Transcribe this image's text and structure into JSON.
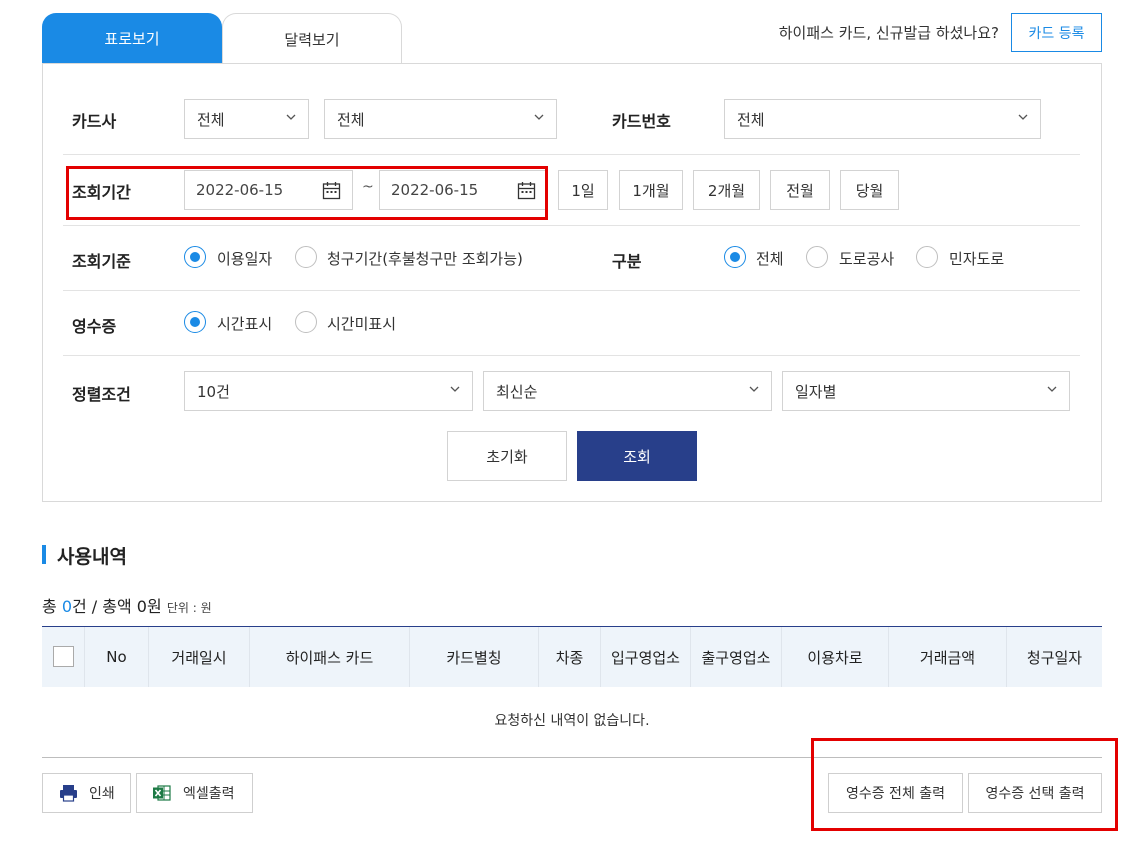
{
  "tabs": [
    {
      "label": "표로보기",
      "active": true
    },
    {
      "label": "달력보기",
      "active": false
    }
  ],
  "header": {
    "question": "하이패스 카드, 신규발급 하셨나요?",
    "card_register_label": "카드 등록"
  },
  "filters": {
    "card_company": {
      "label": "카드사",
      "select1": "전체",
      "select2": "전체"
    },
    "card_number": {
      "label": "카드번호",
      "select": "전체"
    },
    "period": {
      "label": "조회기간",
      "start": "2022-06-15",
      "separator": "~",
      "end": "2022-06-15",
      "buttons": [
        "1일",
        "1개월",
        "2개월",
        "전월",
        "당월"
      ]
    },
    "criteria": {
      "label": "조회기준",
      "options": [
        {
          "label": "이용일자",
          "selected": true
        },
        {
          "label": "청구기간(후불청구만 조회가능)",
          "selected": false
        }
      ]
    },
    "division": {
      "label": "구분",
      "options": [
        {
          "label": "전체",
          "selected": true
        },
        {
          "label": "도로공사",
          "selected": false
        },
        {
          "label": "민자도로",
          "selected": false
        }
      ]
    },
    "receipt": {
      "label": "영수증",
      "options": [
        {
          "label": "시간표시",
          "selected": true
        },
        {
          "label": "시간미표시",
          "selected": false
        }
      ]
    },
    "sort": {
      "label": "정렬조건",
      "select1": "10건",
      "select2": "최신순",
      "select3": "일자별"
    },
    "reset_label": "초기화",
    "search_label": "조회"
  },
  "history": {
    "title": "사용내역",
    "summary_prefix": "총 ",
    "count": "0",
    "summary_mid": "건 / 총액 0원",
    "unit": "단위 : 원",
    "columns": [
      "No",
      "거래일시",
      "하이패스 카드",
      "카드별칭",
      "차종",
      "입구영업소",
      "출구영업소",
      "이용차로",
      "거래금액",
      "청구일자"
    ],
    "empty_message": "요청하신 내역이 없습니다."
  },
  "footer": {
    "print_label": "인쇄",
    "excel_label": "엑셀출력",
    "receipt_all_label": "영수증 전체 출력",
    "receipt_selected_label": "영수증 선택 출력"
  },
  "colors": {
    "accent": "#1a8ae5",
    "navy": "#283f8a",
    "highlight": "#e30000",
    "excel": "#1d7a45"
  },
  "icons": [
    "chevron-down-icon",
    "calendar-icon",
    "printer-icon",
    "excel-icon"
  ]
}
